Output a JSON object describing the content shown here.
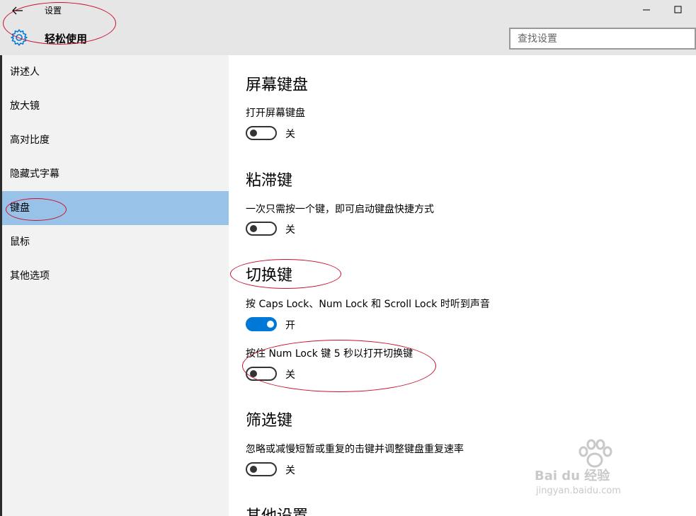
{
  "window": {
    "title": "设置",
    "minimize_icon": "minimize-icon",
    "maximize_icon": "maximize-icon"
  },
  "header": {
    "title": "轻松使用",
    "icon": "gear-icon",
    "back_icon": "back-arrow-icon"
  },
  "search": {
    "placeholder": "查找设置"
  },
  "sidebar": {
    "items": [
      {
        "label": "讲述人",
        "selected": false
      },
      {
        "label": "放大镜",
        "selected": false
      },
      {
        "label": "高对比度",
        "selected": false
      },
      {
        "label": "隐藏式字幕",
        "selected": false
      },
      {
        "label": "键盘",
        "selected": true
      },
      {
        "label": "鼠标",
        "selected": false
      },
      {
        "label": "其他选项",
        "selected": false
      }
    ]
  },
  "main": {
    "sections": [
      {
        "title": "屏幕键盘",
        "settings": [
          {
            "desc": "打开屏幕键盘",
            "state": "off",
            "state_label": "关"
          }
        ]
      },
      {
        "title": "粘滞键",
        "settings": [
          {
            "desc": "一次只需按一个键，即可启动键盘快捷方式",
            "state": "off",
            "state_label": "关"
          }
        ]
      },
      {
        "title": "切换键",
        "settings": [
          {
            "desc": "按 Caps Lock、Num Lock 和 Scroll Lock 时听到声音",
            "state": "on",
            "state_label": "开"
          },
          {
            "desc": "按住 Num Lock 键 5 秒以打开切换键",
            "state": "off",
            "state_label": "关"
          }
        ]
      },
      {
        "title": "筛选键",
        "settings": [
          {
            "desc": "忽略或减慢短暂或重复的击键并调整键盘重复速率",
            "state": "off",
            "state_label": "关"
          }
        ]
      },
      {
        "title": "其他设置"
      }
    ]
  },
  "watermark": {
    "brand": "Bai du 经验",
    "url": "jingyan.baidu.com"
  },
  "colors": {
    "accent": "#0078d7",
    "selected": "#99c2e8",
    "annotation": "#c8102e"
  }
}
